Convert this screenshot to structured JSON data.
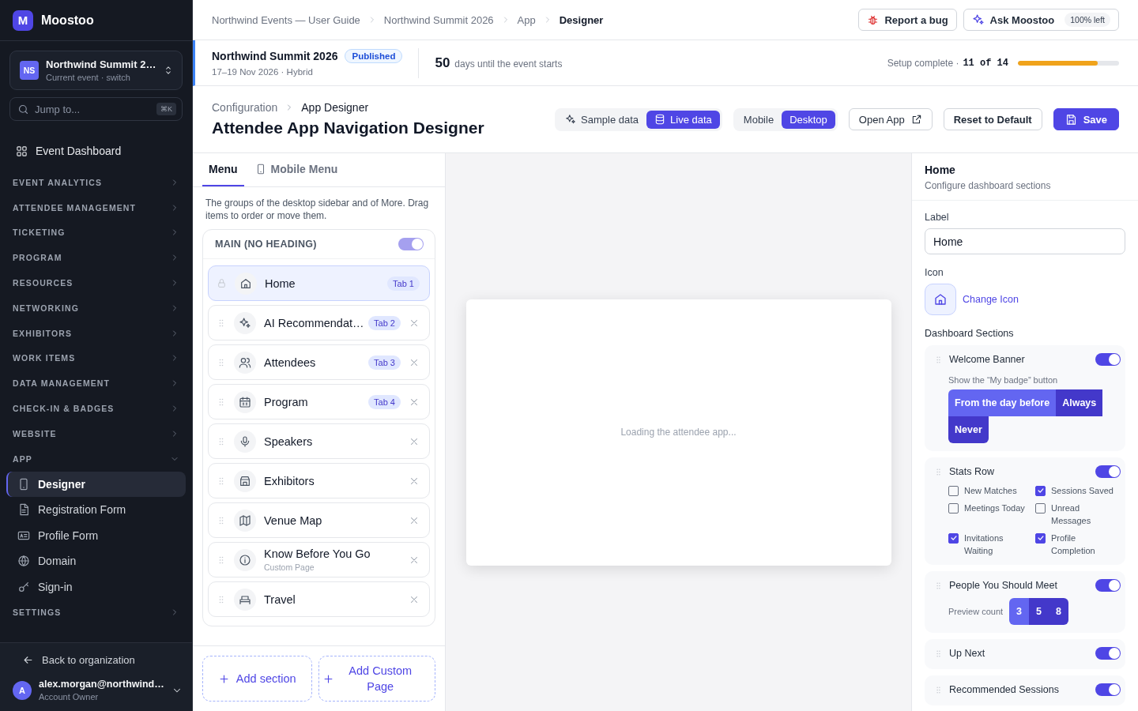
{
  "sidebar": {
    "brand": {
      "logo": "M",
      "name": "Moostoo"
    },
    "event_switcher": {
      "avatar": "NS",
      "name": "Northwind Summit 2…",
      "subtitle": "Current event · switch"
    },
    "search": {
      "placeholder": "Jump to...",
      "shortcut": "⌘K"
    },
    "dashboard_link": "Event Dashboard",
    "groups": [
      {
        "label": "EVENT ANALYTICS",
        "expanded": false
      },
      {
        "label": "ATTENDEE MANAGEMENT",
        "expanded": false
      },
      {
        "label": "TICKETING",
        "expanded": false
      },
      {
        "label": "PROGRAM",
        "expanded": false
      },
      {
        "label": "RESOURCES",
        "expanded": false
      },
      {
        "label": "NETWORKING",
        "expanded": false
      },
      {
        "label": "EXHIBITORS",
        "expanded": false
      },
      {
        "label": "WORK ITEMS",
        "expanded": false
      },
      {
        "label": "DATA MANAGEMENT",
        "expanded": false
      },
      {
        "label": "CHECK-IN & BADGES",
        "expanded": false
      },
      {
        "label": "WEBSITE",
        "expanded": false
      },
      {
        "label": "APP",
        "expanded": true,
        "items": [
          {
            "label": "Designer",
            "selected": true
          },
          {
            "label": "Registration Form",
            "selected": false
          },
          {
            "label": "Profile Form",
            "selected": false
          },
          {
            "label": "Domain",
            "selected": false
          },
          {
            "label": "Sign-in",
            "selected": false
          }
        ]
      },
      {
        "label": "SETTINGS",
        "expanded": false
      }
    ],
    "back_link": "Back to organization",
    "account": {
      "avatar": "A",
      "email": "alex.morgan@northwind…",
      "role": "Account Owner"
    }
  },
  "breadcrumbs": [
    "Northwind Events — User Guide",
    "Northwind Summit 2026",
    "App",
    "Designer"
  ],
  "header_actions": {
    "report_bug": "Report a bug",
    "ask": "Ask Moostoo",
    "quota": "100% left"
  },
  "event": {
    "name": "Northwind Summit 2026",
    "status": "Published",
    "dates": "17–19 Nov 2026 · Hybrid",
    "days": "50",
    "days_text": "days until the event starts",
    "setup_label": "Setup complete ·",
    "setup_count": "11 of 14",
    "level": 0.79
  },
  "page": {
    "crumbs": [
      "Configuration",
      "App Designer"
    ],
    "title": "Attendee App Navigation Designer",
    "data_toggle": [
      {
        "label": "Sample data",
        "selected": false
      },
      {
        "label": "Live data",
        "selected": true
      }
    ],
    "view_toggle": [
      {
        "label": "Mobile",
        "selected": false
      },
      {
        "label": "Desktop",
        "selected": true
      }
    ],
    "buttons": {
      "open": "Open App",
      "reset": "Reset to Default",
      "save": "Save"
    }
  },
  "menu_panel": {
    "tabs": [
      {
        "label": "Menu",
        "selected": true
      },
      {
        "label": "Mobile Menu",
        "selected": false
      }
    ],
    "description": "The groups of the desktop sidebar and of More. Drag items to order or move them.",
    "section": {
      "heading": "MAIN (NO HEADING)",
      "on": true,
      "disabled": true,
      "items": [
        {
          "label": "Home",
          "tab": "Tab 1",
          "locked": true,
          "selected": true
        },
        {
          "label": "AI Recommendat…",
          "tab": "Tab 2",
          "locked": false,
          "selected": false
        },
        {
          "label": "Attendees",
          "tab": "Tab 3",
          "locked": false,
          "selected": false
        },
        {
          "label": "Program",
          "tab": "Tab 4",
          "locked": false,
          "selected": false
        },
        {
          "label": "Speakers",
          "locked": false,
          "selected": false
        },
        {
          "label": "Exhibitors",
          "locked": false,
          "selected": false
        },
        {
          "label": "Venue Map",
          "locked": false,
          "selected": false
        },
        {
          "label": "Know Before You Go",
          "subtitle": "Custom Page",
          "locked": false,
          "selected": false
        },
        {
          "label": "Travel",
          "locked": false,
          "selected": false
        }
      ]
    },
    "add_section": "Add section",
    "add_page": "Add Custom Page"
  },
  "preview": {
    "message": "Loading the attendee app..."
  },
  "properties": {
    "title": "Home",
    "subtitle": "Configure dashboard sections",
    "label_field": {
      "label": "Label",
      "value": "Home"
    },
    "icon_field": {
      "label": "Icon",
      "action": "Change Icon"
    },
    "sections_heading": "Dashboard Sections",
    "sections": [
      {
        "kind": "choice",
        "name": "Welcome Banner",
        "on": true,
        "prompt": "Show the “My badge” button",
        "options": [
          {
            "label": "From the day before",
            "selected": true
          },
          {
            "label": "Always",
            "selected": false
          },
          {
            "label": "Never",
            "selected": false
          }
        ]
      },
      {
        "kind": "checks",
        "name": "Stats Row",
        "on": true,
        "options": [
          {
            "label": "New Matches",
            "checked": false
          },
          {
            "label": "Sessions Saved",
            "checked": true
          },
          {
            "label": "Meetings Today",
            "checked": false
          },
          {
            "label": "Unread Messages",
            "checked": false
          },
          {
            "label": "Invitations Waiting",
            "checked": true
          },
          {
            "label": "Profile Completion",
            "checked": true
          }
        ]
      },
      {
        "kind": "count",
        "name": "People You Should Meet",
        "on": true,
        "prompt": "Preview count",
        "options": [
          {
            "label": "3",
            "selected": true
          },
          {
            "label": "5",
            "selected": false
          },
          {
            "label": "8",
            "selected": false
          }
        ]
      },
      {
        "kind": "plain",
        "name": "Up Next",
        "on": true
      },
      {
        "kind": "plain",
        "name": "Recommended Sessions",
        "on": true
      }
    ]
  }
}
